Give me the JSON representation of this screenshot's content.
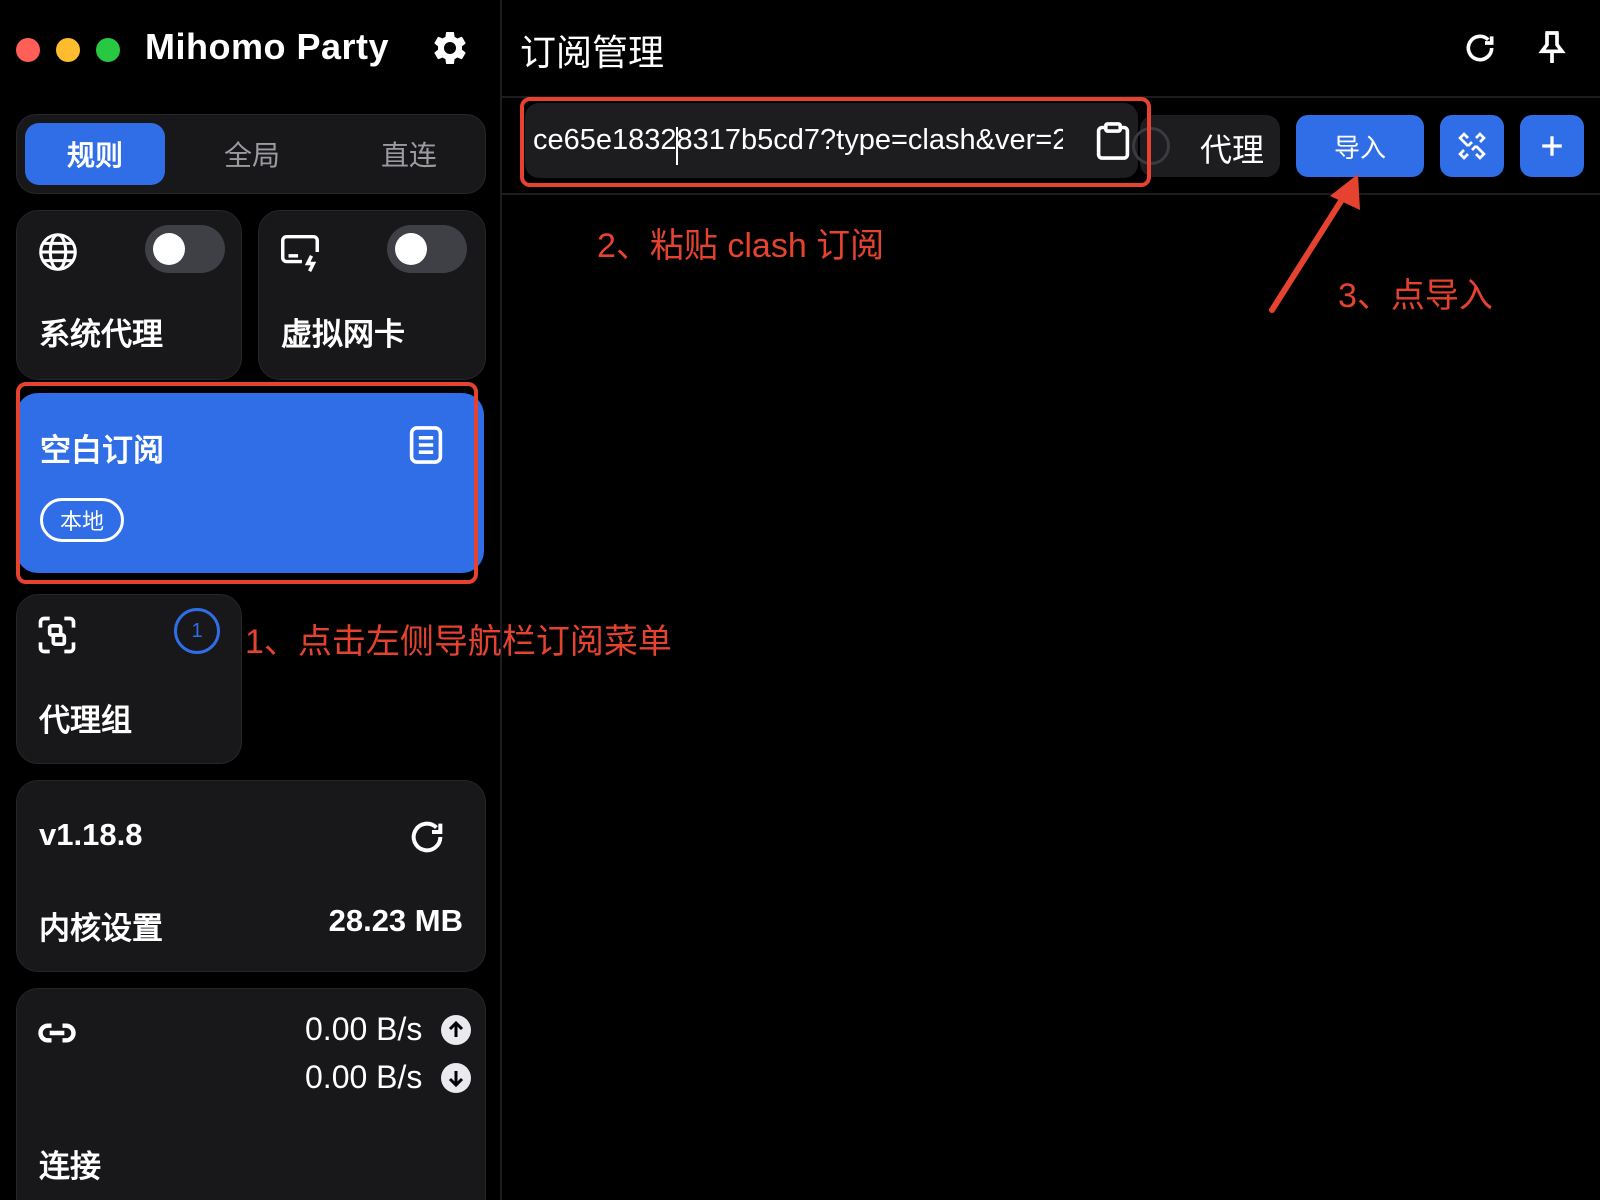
{
  "app": {
    "title": "Mihomo Party",
    "icons": {
      "settings": "gear-icon"
    }
  },
  "mode": {
    "options": [
      "规则",
      "全局",
      "直连"
    ],
    "selected": "规则"
  },
  "cards": {
    "system_proxy": {
      "label": "系统代理",
      "icon": "globe-icon",
      "enabled": false
    },
    "tun": {
      "label": "虚拟网卡",
      "icon": "monitor-bolt-icon",
      "enabled": false
    },
    "subscription": {
      "label": "空白订阅",
      "tag": "本地",
      "icon": "document-icon"
    },
    "proxy_group": {
      "label": "代理组",
      "icon": "scan-icon",
      "badge": "1"
    },
    "core": {
      "version": "v1.18.8",
      "label": "内核设置",
      "memory": "28.23 MB",
      "icon": "refresh-icon"
    },
    "connection": {
      "label": "连接",
      "upload": "0.00 B/s",
      "download": "0.00 B/s",
      "icon": "link-icon"
    }
  },
  "main": {
    "title": "订阅管理",
    "url_value": "ce65e18328317b5cd7?type=clash&ver=2",
    "proxy_label": "代理",
    "import_label": "导入",
    "icons": {
      "refresh": "refresh-icon",
      "pin": "pin-icon",
      "paste": "clipboard-icon",
      "link": "chain-icon",
      "add": "plus-icon"
    }
  },
  "annotations": {
    "step1": "1、点击左侧导航栏订阅菜单",
    "step2": "2、粘贴 clash 订阅",
    "step3": "3、点导入"
  },
  "colors": {
    "accent": "#2f6ee6",
    "annotation": "#e5432f",
    "card_bg": "#18181b"
  }
}
